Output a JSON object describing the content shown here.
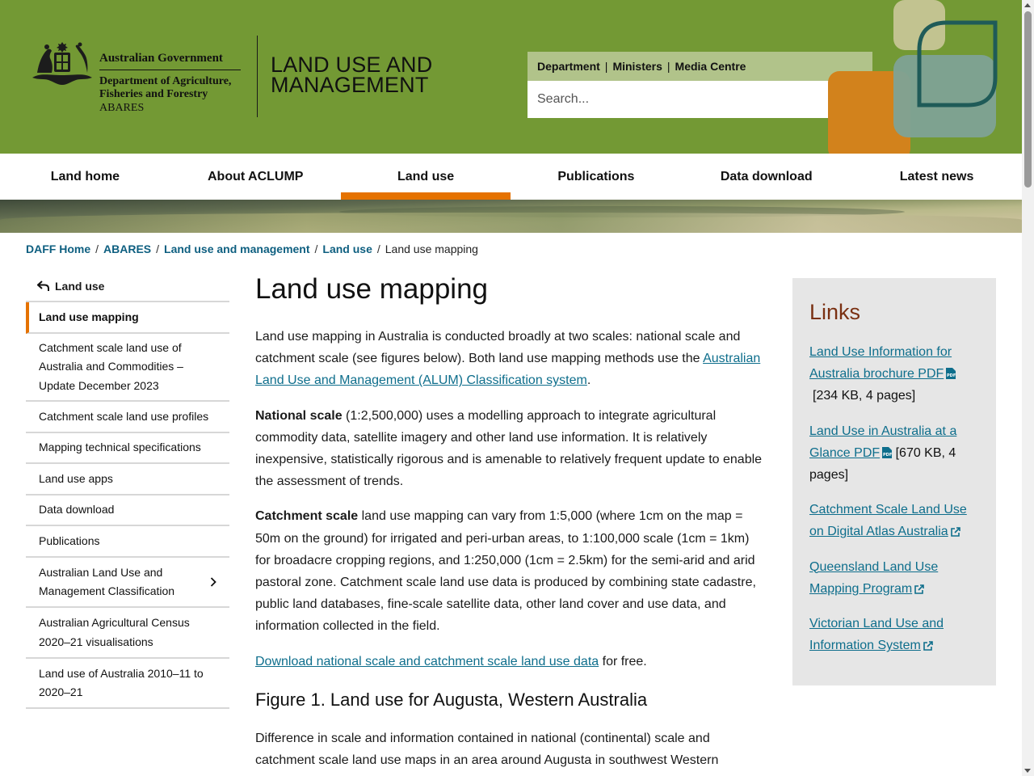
{
  "header": {
    "gov_title": "Australian Government",
    "dept_line1": "Department of Agriculture,",
    "dept_line2": "Fisheries and Forestry",
    "abares": "ABARES",
    "site_line1": "LAND USE AND",
    "site_line2": "MANAGEMENT",
    "util_links": [
      "Department",
      "Ministers",
      "Media Centre"
    ],
    "search_placeholder": "Search..."
  },
  "nav": {
    "items": [
      "Land home",
      "About ACLUMP",
      "Land use",
      "Publications",
      "Data download",
      "Latest news"
    ],
    "active": "Land use"
  },
  "breadcrumb": {
    "links": [
      "DAFF Home",
      "ABARES",
      "Land use and management",
      "Land use"
    ],
    "current": "Land use mapping"
  },
  "sidenav": {
    "back": "Land use",
    "items": [
      "Land use mapping",
      "Catchment scale land use of Australia and Commodities – Update December 2023",
      "Catchment scale land use profiles",
      "Mapping technical specifications",
      "Land use apps",
      "Data download",
      "Publications",
      "Australian Land Use and Management Classification",
      "Australian Agricultural Census 2020–21 visualisations",
      "Land use of Australia 2010–11 to 2020–21"
    ]
  },
  "main": {
    "title": "Land use mapping",
    "p1_text": "Land use mapping in Australia is conducted broadly at two scales: national scale and catchment scale (see figures below). Both land use mapping methods use the ",
    "p1_link": "Australian Land Use and Management (ALUM) Classification system",
    "p1_end": ".",
    "p2_bold": "National scale",
    "p2_text": " (1:2,500,000) uses a modelling approach to integrate agricultural commodity data, satellite imagery and other land use information. It is relatively inexpensive, statistically rigorous and is amenable to relatively frequent update to enable the assessment of trends.",
    "p3_bold": "Catchment scale",
    "p3_text": " land use mapping can vary from 1:5,000 (where 1cm on the map = 50m on the ground) for irrigated and peri-urban areas, to 1:100,000 scale (1cm = 1km) for broadacre cropping regions, and 1:250,000 (1cm = 2.5km) for the semi-arid and arid pastoral zone. Catchment scale land use data is produced by combining state cadastre, public land databases, fine-scale satellite data, other land cover and use data, and information collected in the field.",
    "p4_link": "Download national scale and catchment scale land use data",
    "p4_text": " for free.",
    "fig_title": "Figure 1. Land use for Augusta, Western Australia",
    "fig_desc": "Difference in scale and information contained in national (continental) scale and catchment scale land use maps in an area around Augusta in southwest Western Australia."
  },
  "links": {
    "heading": "Links",
    "items": [
      {
        "label": "Land Use Information for Australia brochure PDF",
        "icon": "pdf-icon",
        "note": "[234 KB, 4 pages]"
      },
      {
        "label": "Land Use in Australia at a Glance PDF",
        "icon": "pdf-icon",
        "note": "[670 KB, 4 pages]"
      },
      {
        "label": "Catchment Scale Land Use on Digital Atlas Australia",
        "icon": "external-link-icon",
        "note": ""
      },
      {
        "label": "Queensland Land Use Mapping Program",
        "icon": "external-link-icon",
        "note": ""
      },
      {
        "label": "Victorian Land Use and Information System",
        "icon": "external-link-icon",
        "note": ""
      }
    ]
  },
  "colors": {
    "header_bg": "#739934",
    "util_bar_bg": "#b1c38a",
    "accent_orange": "#e57200",
    "link_blue": "#0e6e8c",
    "links_heading": "#7a3012",
    "links_box_bg": "#e6e6e6"
  }
}
